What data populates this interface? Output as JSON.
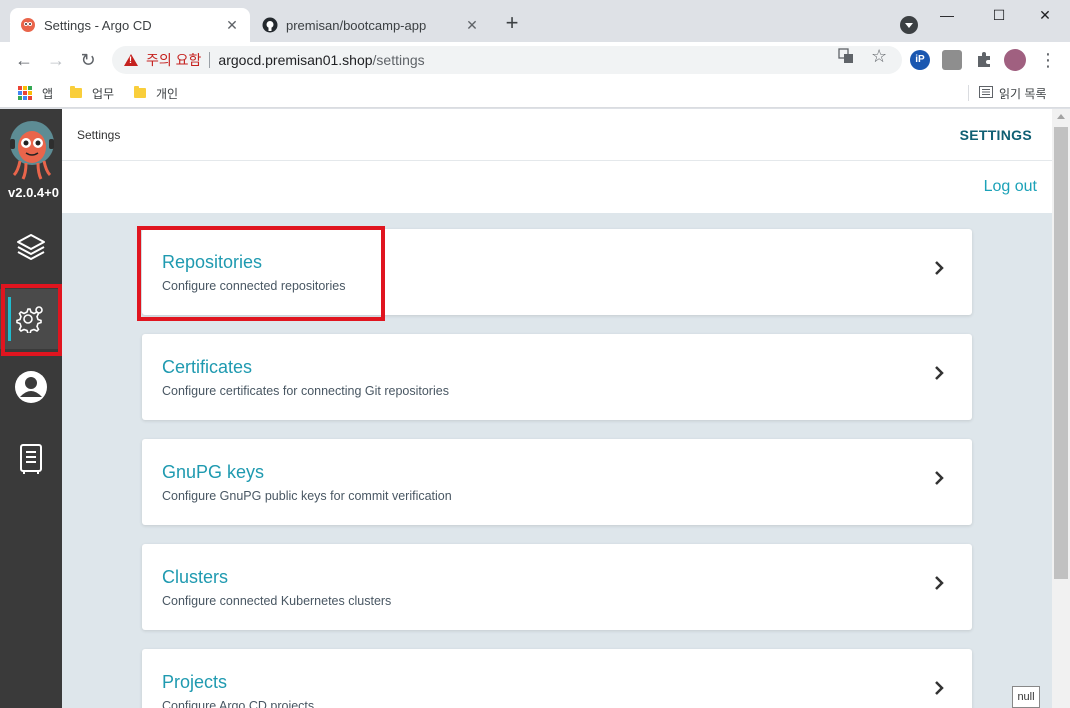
{
  "browser": {
    "tabs": [
      {
        "title": "Settings - Argo CD",
        "favicon": "argo-icon",
        "active": true
      },
      {
        "title": "premisan/bootcamp-app",
        "favicon": "github-icon",
        "active": false
      }
    ],
    "close_glyph": "✕",
    "new_tab_glyph": "+",
    "window_controls": {
      "minimize": "—",
      "maximize": "☐",
      "close": "✕"
    },
    "nav": {
      "back": "←",
      "forward": "→",
      "reload": "↻"
    },
    "address": {
      "security_label": "주의 요함",
      "host": "argocd.premisan01.shop",
      "path": "/settings"
    },
    "omnibox_icons": {
      "translate": "translate-icon",
      "bookmark_star": "☆"
    },
    "extensions": {
      "ip_label": "iP",
      "menu_dots": "⋮"
    },
    "bookmarks": [
      {
        "label": "앱",
        "icon": "apps-grid-icon"
      },
      {
        "label": "업무",
        "icon": "folder-icon"
      },
      {
        "label": "개인",
        "icon": "folder-icon"
      }
    ],
    "reading_list": "읽기 목록"
  },
  "argo": {
    "version": "v2.0.4+0",
    "breadcrumb": "Settings",
    "page_title": "SETTINGS",
    "logout_label": "Log out",
    "nav_items": [
      {
        "name": "applications",
        "icon": "layers-icon"
      },
      {
        "name": "settings",
        "icon": "gear-icon",
        "active": true
      },
      {
        "name": "user-info",
        "icon": "user-icon"
      },
      {
        "name": "documentation",
        "icon": "docs-icon"
      }
    ],
    "settings_cards": [
      {
        "title": "Repositories",
        "description": "Configure connected repositories"
      },
      {
        "title": "Certificates",
        "description": "Configure certificates for connecting Git repositories"
      },
      {
        "title": "GnuPG keys",
        "description": "Configure GnuPG public keys for commit verification"
      },
      {
        "title": "Clusters",
        "description": "Configure connected Kubernetes clusters"
      },
      {
        "title": "Projects",
        "description": "Configure Argo CD projects"
      }
    ]
  },
  "null_badge": "null",
  "colors": {
    "accent": "#1f9ab0",
    "highlight": "#e0151f",
    "sidebar": "#3a3a3a"
  }
}
